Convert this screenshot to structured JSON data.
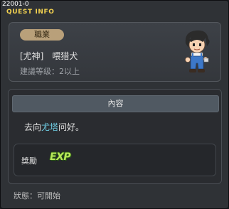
{
  "window": {
    "quest_id": "22001-0",
    "title": "QUEST INFO"
  },
  "header": {
    "job_label": "職業",
    "job_name": "[尤神]　喂猎犬",
    "recommended_level": "建議等级：2以上"
  },
  "content": {
    "section_title": "內容",
    "text_before": "去向",
    "npc_name": "尤塔",
    "text_after": "问好。",
    "reward_label": "獎勵",
    "reward_icon": "EXP"
  },
  "status": {
    "text": "狀態：可開始"
  },
  "colors": {
    "title": "#f3d250",
    "npc_highlight": "#6ecde3",
    "exp_icon": "#b8e85a"
  }
}
